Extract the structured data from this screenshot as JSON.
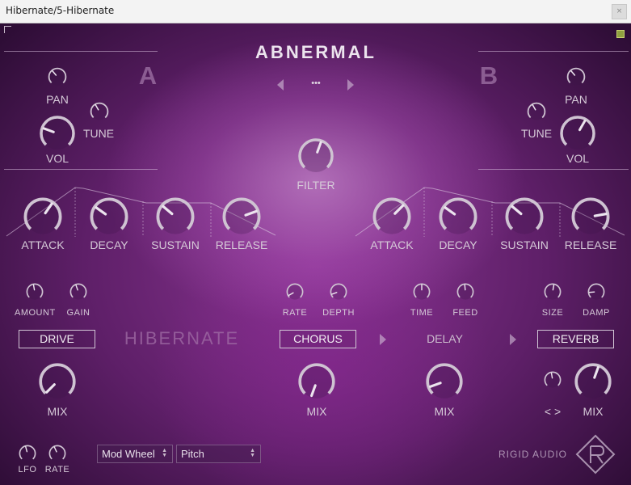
{
  "window": {
    "title": "Hibernate/5-Hibernate",
    "close_glyph": "×"
  },
  "header": {
    "preset_name": "ABNERMAL",
    "menu_glyph": "•••"
  },
  "layer_a": {
    "letter": "A",
    "pan": "PAN",
    "tune": "TUNE",
    "vol": "VOL"
  },
  "layer_b": {
    "letter": "B",
    "pan": "PAN",
    "tune": "TUNE",
    "vol": "VOL"
  },
  "filter": {
    "label": "FILTER"
  },
  "env_a": {
    "attack": "ATTACK",
    "decay": "DECAY",
    "sustain": "SUSTAIN",
    "release": "RELEASE"
  },
  "env_b": {
    "attack": "ATTACK",
    "decay": "DECAY",
    "sustain": "SUSTAIN",
    "release": "RELEASE"
  },
  "drive": {
    "amount": "AMOUNT",
    "gain": "GAIN",
    "button": "DRIVE",
    "mix": "MIX"
  },
  "logo_text": "HIBERNATE",
  "chorus": {
    "rate": "RATE",
    "depth": "DEPTH",
    "button": "CHORUS",
    "mix": "MIX"
  },
  "delay": {
    "time": "TIME",
    "feed": "FEED",
    "button": "DELAY",
    "mix": "MIX"
  },
  "reverb": {
    "size": "SIZE",
    "damp": "DAMP",
    "button": "REVERB",
    "width": "< >",
    "mix": "MIX"
  },
  "lfo": {
    "lfo": "LFO",
    "rate": "RATE"
  },
  "mod_source": {
    "selected": "Mod Wheel"
  },
  "mod_target": {
    "selected": "Pitch"
  },
  "brand": {
    "name": "RIGID AUDIO"
  },
  "colors": {
    "background": "#6a2574",
    "text": "#d6cad8",
    "knob_ring": "#cfc3d2",
    "button_border": "#d2c6d6"
  }
}
